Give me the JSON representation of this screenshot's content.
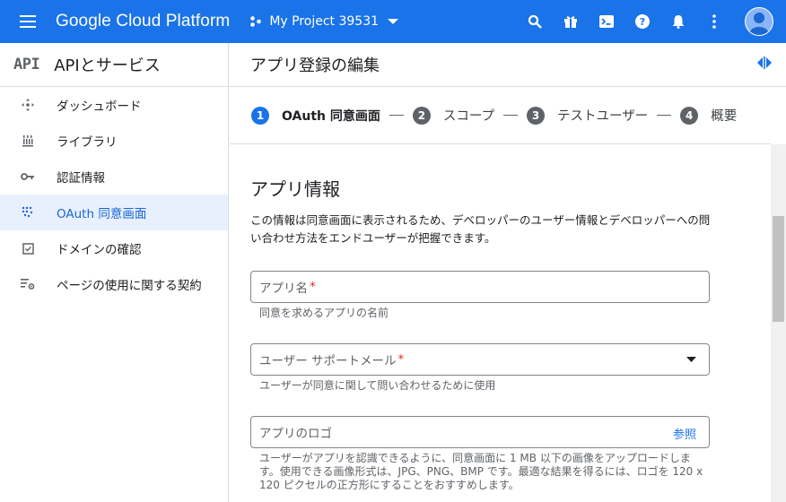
{
  "topbar": {
    "brand": "Google Cloud Platform",
    "project": "My Project 39531",
    "icons": [
      "search-icon",
      "gift-icon",
      "cloud-shell-icon",
      "help-icon",
      "notifications-icon",
      "more-vert-icon",
      "avatar"
    ]
  },
  "sidebar": {
    "logo": "API",
    "title": "APIとサービス",
    "items": [
      {
        "label": "ダッシュボード",
        "icon": "dashboard-icon"
      },
      {
        "label": "ライブラリ",
        "icon": "library-icon"
      },
      {
        "label": "認証情報",
        "icon": "key-icon"
      },
      {
        "label": "OAuth 同意画面",
        "icon": "oauth-icon",
        "active": true
      },
      {
        "label": "ドメインの確認",
        "icon": "checkbox-icon"
      },
      {
        "label": "ページの使用に関する契約",
        "icon": "settings-list-icon"
      }
    ]
  },
  "main": {
    "title": "アプリ登録の編集",
    "steps": [
      {
        "num": "1",
        "label": "OAuth 同意画面",
        "active": true
      },
      {
        "num": "2",
        "label": "スコープ"
      },
      {
        "num": "3",
        "label": "テストユーザー"
      },
      {
        "num": "4",
        "label": "概要"
      }
    ],
    "section": {
      "title": "アプリ情報",
      "desc": "この情報は同意画面に表示されるため、デベロッパーのユーザー情報とデベロッパーへの問い合わせ方法をエンドユーザーが把握できます。"
    },
    "fields": {
      "app_name": {
        "label": "アプリ名",
        "required": "*",
        "hint": "同意を求めるアプリの名前"
      },
      "support_email": {
        "label": "ユーザー サポートメール",
        "required": "*",
        "hint": "ユーザーが同意に関して問い合わせるために使用"
      },
      "logo": {
        "label": "アプリのロゴ",
        "browse": "参照",
        "hint": "ユーザーがアプリを認識できるように、同意画面に 1 MB 以下の画像をアップロードします。使用できる画像形式は、JPG、PNG、BMP です。最適な結果を得るには、ロゴを 120 x 120 ピクセルの正方形にすることをおすすめします。"
      }
    }
  },
  "colors": {
    "accent": "#1a73e8",
    "active_bg": "#e8f0fe",
    "required": "#d93025"
  }
}
